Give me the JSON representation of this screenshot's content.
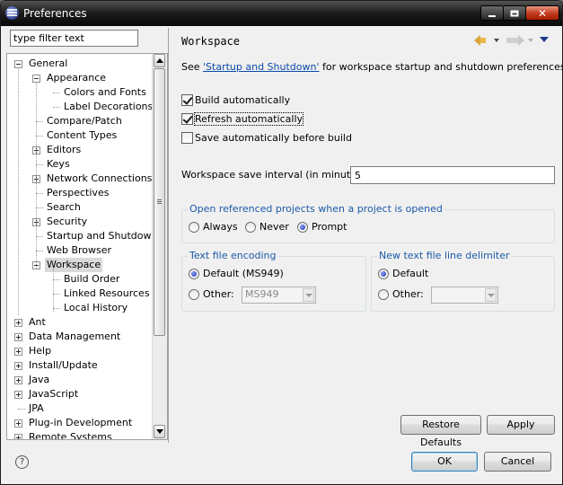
{
  "window": {
    "title": "Preferences"
  },
  "filter": {
    "placeholder": "type filter text",
    "value": "type filter text"
  },
  "tree": [
    {
      "label": "General",
      "depth": 0,
      "expander": "minus"
    },
    {
      "label": "Appearance",
      "depth": 1,
      "expander": "minus"
    },
    {
      "label": "Colors and Fonts",
      "depth": 2,
      "expander": "none"
    },
    {
      "label": "Label Decorations",
      "depth": 2,
      "expander": "none"
    },
    {
      "label": "Compare/Patch",
      "depth": 1,
      "expander": "none"
    },
    {
      "label": "Content Types",
      "depth": 1,
      "expander": "none"
    },
    {
      "label": "Editors",
      "depth": 1,
      "expander": "plus"
    },
    {
      "label": "Keys",
      "depth": 1,
      "expander": "none"
    },
    {
      "label": "Network Connections",
      "depth": 1,
      "expander": "plus"
    },
    {
      "label": "Perspectives",
      "depth": 1,
      "expander": "none"
    },
    {
      "label": "Search",
      "depth": 1,
      "expander": "none"
    },
    {
      "label": "Security",
      "depth": 1,
      "expander": "plus"
    },
    {
      "label": "Startup and Shutdown",
      "depth": 1,
      "expander": "none"
    },
    {
      "label": "Web Browser",
      "depth": 1,
      "expander": "none"
    },
    {
      "label": "Workspace",
      "depth": 1,
      "expander": "minus",
      "selected": true
    },
    {
      "label": "Build Order",
      "depth": 2,
      "expander": "none"
    },
    {
      "label": "Linked Resources",
      "depth": 2,
      "expander": "none"
    },
    {
      "label": "Local History",
      "depth": 2,
      "expander": "none"
    },
    {
      "label": "Ant",
      "depth": 0,
      "expander": "plus"
    },
    {
      "label": "Data Management",
      "depth": 0,
      "expander": "plus"
    },
    {
      "label": "Help",
      "depth": 0,
      "expander": "plus"
    },
    {
      "label": "Install/Update",
      "depth": 0,
      "expander": "plus"
    },
    {
      "label": "Java",
      "depth": 0,
      "expander": "plus"
    },
    {
      "label": "JavaScript",
      "depth": 0,
      "expander": "plus"
    },
    {
      "label": "JPA",
      "depth": 0,
      "expander": "none"
    },
    {
      "label": "Plug-in Development",
      "depth": 0,
      "expander": "plus"
    },
    {
      "label": "Remote Systems",
      "depth": 0,
      "expander": "plus"
    }
  ],
  "page": {
    "title": "Workspace",
    "see_prefix": "See ",
    "see_link": "'Startup and Shutdown'",
    "see_suffix": " for workspace startup and shutdown preferences.",
    "build_auto": {
      "label": "Build automatically",
      "checked": true
    },
    "refresh_auto": {
      "label": "Refresh automatically",
      "checked": true
    },
    "save_auto": {
      "label": "Save automatically before build",
      "checked": false
    },
    "interval_label": "Workspace save interval (in minutes):",
    "interval_value": "5",
    "open_group": {
      "title": "Open referenced projects when a project is opened",
      "options": [
        "Always",
        "Never",
        "Prompt"
      ],
      "selected": "Prompt"
    },
    "encoding_group": {
      "title": "Text file encoding",
      "default_label": "Default (MS949)",
      "other_label": "Other:",
      "other_value": "MS949",
      "selected": "Default"
    },
    "delimiter_group": {
      "title": "New text file line delimiter",
      "default_label": "Default",
      "other_label": "Other:",
      "other_value": "",
      "selected": "Default"
    },
    "restore_label": "Restore Defaults",
    "apply_label": "Apply"
  },
  "footer": {
    "ok_label": "OK",
    "cancel_label": "Cancel",
    "help_glyph": "?"
  },
  "colors": {
    "link": "#0b4aa8",
    "group_title": "#1a5aa8",
    "title_bar": "#1e1e1e",
    "close_button": "#c33f23"
  }
}
